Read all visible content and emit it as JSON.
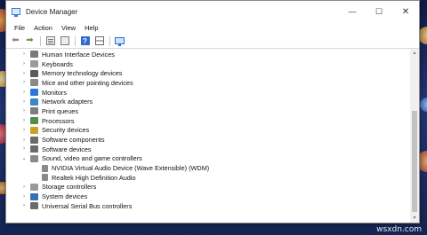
{
  "window": {
    "title": "Device Manager",
    "controls": {
      "minimize": "—",
      "maximize": "☐",
      "close": "✕"
    }
  },
  "menu": [
    "File",
    "Action",
    "View",
    "Help"
  ],
  "toolbar": [
    "back-icon",
    "forward-icon",
    "properties-icon",
    "list-icon",
    "help-icon",
    "grid-icon",
    "monitor-icon"
  ],
  "tree": [
    {
      "label": "Human Interface Devices",
      "icon_color": "#7a7a7a",
      "expanded": false
    },
    {
      "label": "Keyboards",
      "icon_color": "#9a9a9a",
      "expanded": false
    },
    {
      "label": "Memory technology devices",
      "icon_color": "#5a5a5a",
      "expanded": false
    },
    {
      "label": "Mice and other pointing devices",
      "icon_color": "#8a8a8a",
      "expanded": false
    },
    {
      "label": "Monitors",
      "icon_color": "#2a78d6",
      "expanded": false
    },
    {
      "label": "Network adapters",
      "icon_color": "#3a86c9",
      "expanded": false
    },
    {
      "label": "Print queues",
      "icon_color": "#7d7d7d",
      "expanded": false
    },
    {
      "label": "Processors",
      "icon_color": "#4f8f4a",
      "expanded": false
    },
    {
      "label": "Security devices",
      "icon_color": "#c9a227",
      "expanded": false
    },
    {
      "label": "Software components",
      "icon_color": "#6b6b6b",
      "expanded": false
    },
    {
      "label": "Software devices",
      "icon_color": "#6b6b6b",
      "expanded": false
    },
    {
      "label": "Sound, video and game controllers",
      "icon_color": "#8a8a8a",
      "expanded": true,
      "children": [
        {
          "label": "NVIDIA Virtual Audio Device (Wave Extensible) (WDM)",
          "icon_color": "#8a8a8a"
        },
        {
          "label": "Realtek High Definition Audio",
          "icon_color": "#8a8a8a"
        }
      ]
    },
    {
      "label": "Storage controllers",
      "icon_color": "#9a9a9a",
      "expanded": false
    },
    {
      "label": "System devices",
      "icon_color": "#3a6fb8",
      "expanded": false
    },
    {
      "label": "Universal Serial Bus controllers",
      "icon_color": "#6b6b6b",
      "expanded": false
    }
  ],
  "watermark": "wsxdn.com"
}
